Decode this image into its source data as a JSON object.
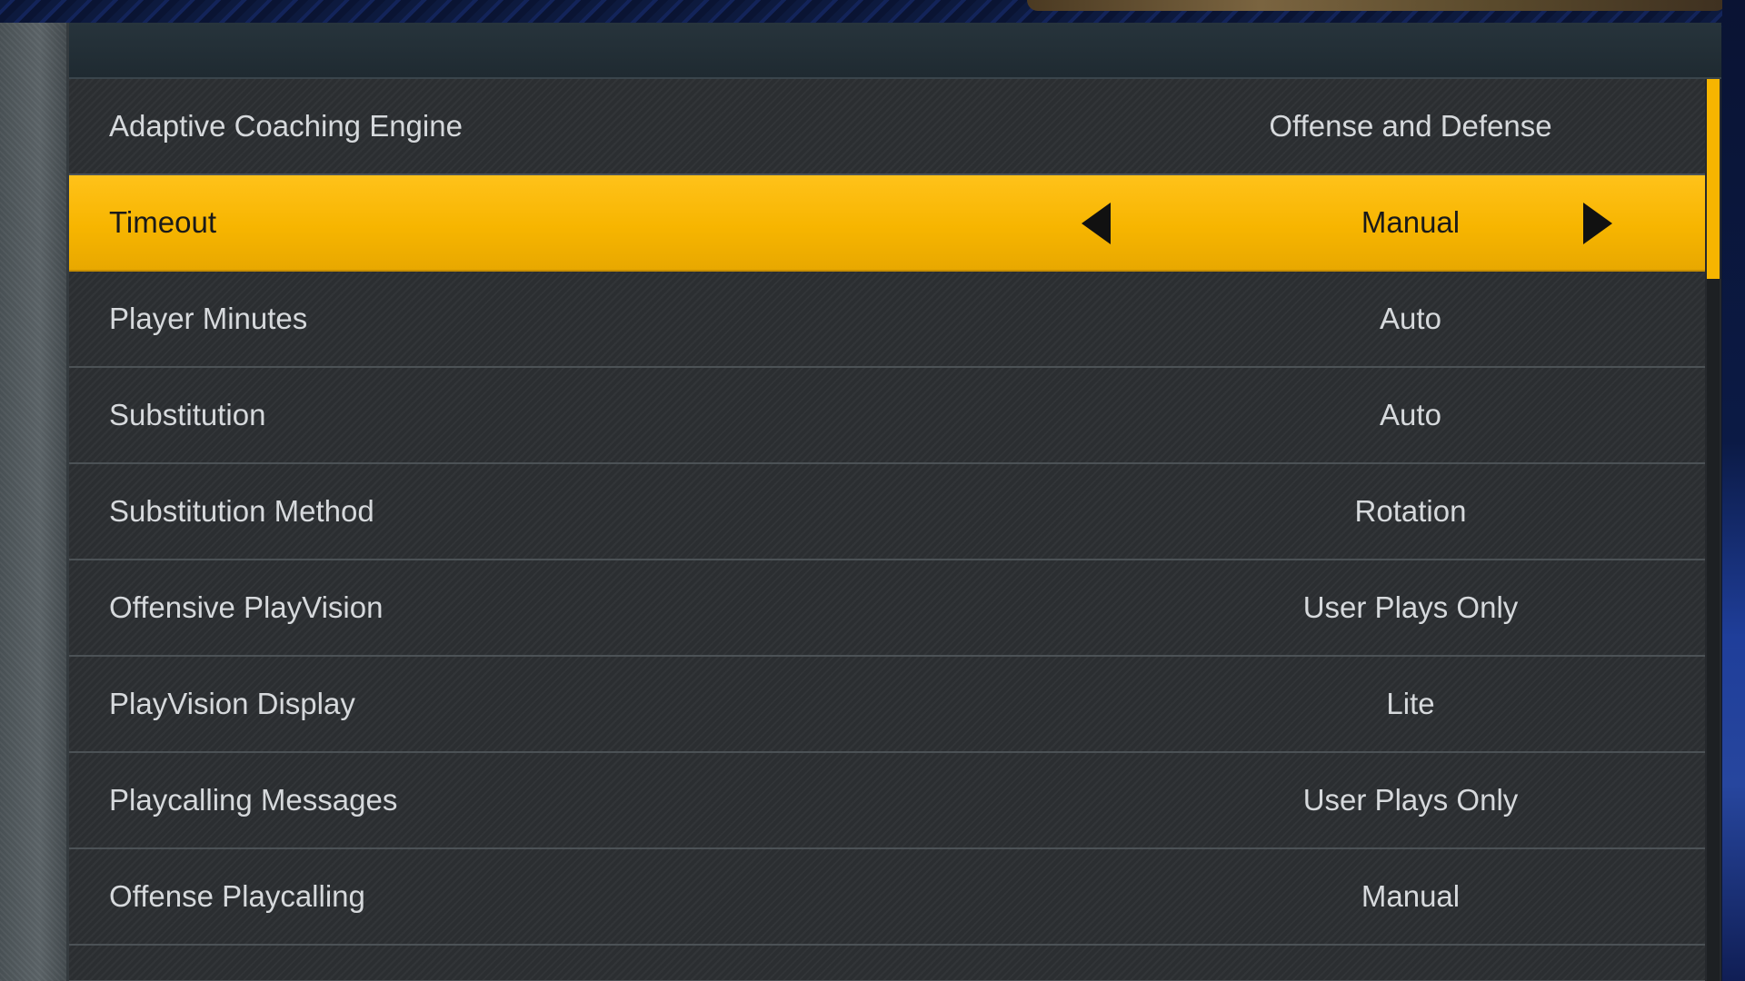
{
  "colors": {
    "accent": "#f7b500",
    "row_background": "#2b2e31",
    "text": "#d6d9dc",
    "selected_text": "#1a1a1a"
  },
  "settings": [
    {
      "label": "Adaptive Coaching Engine",
      "value": "Offense and Defense",
      "selected": false
    },
    {
      "label": "Timeout",
      "value": "Manual",
      "selected": true
    },
    {
      "label": "Player Minutes",
      "value": "Auto",
      "selected": false
    },
    {
      "label": "Substitution",
      "value": "Auto",
      "selected": false
    },
    {
      "label": "Substitution Method",
      "value": "Rotation",
      "selected": false
    },
    {
      "label": "Offensive PlayVision",
      "value": "User Plays Only",
      "selected": false
    },
    {
      "label": "PlayVision Display",
      "value": "Lite",
      "selected": false
    },
    {
      "label": "Playcalling Messages",
      "value": "User Plays Only",
      "selected": false
    },
    {
      "label": "Offense Playcalling",
      "value": "Manual",
      "selected": false
    }
  ],
  "icons": {
    "previous": "caret-left-icon",
    "next": "caret-right-icon"
  }
}
